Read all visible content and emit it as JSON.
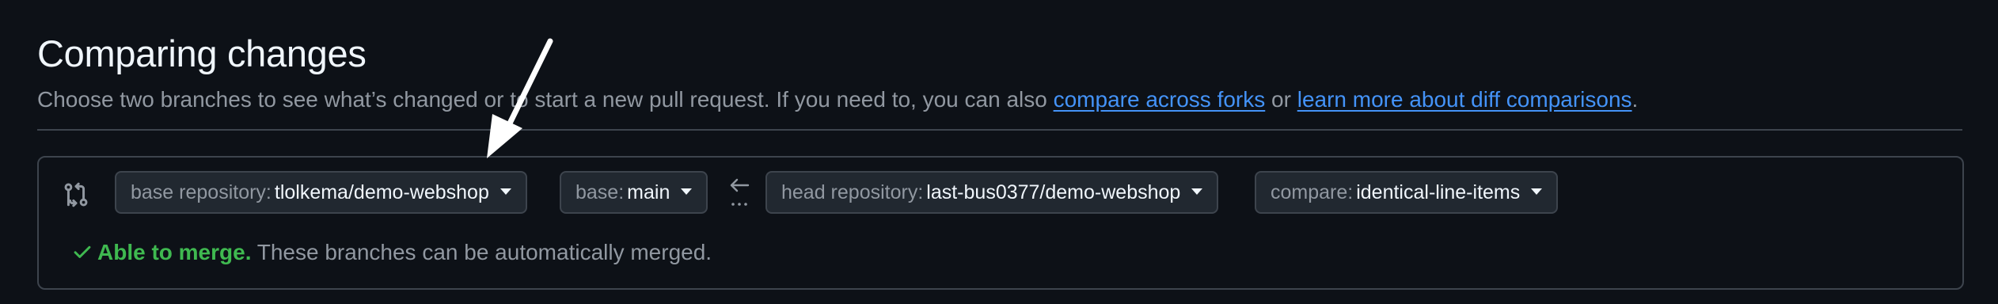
{
  "header": {
    "title": "Comparing changes",
    "subtitle_prefix": "Choose two branches to see what’s changed or to start a new pull request. If you need to, you can also ",
    "link_forks": "compare across forks",
    "subtitle_mid": " or ",
    "link_learn": "learn more about diff comparisons",
    "subtitle_suffix": "."
  },
  "compare_bar": {
    "base_repo_label": "base repository:",
    "base_repo_value": "tlolkema/demo-webshop",
    "base_label": "base:",
    "base_value": "main",
    "head_repo_label": "head repository:",
    "head_repo_value": "last-bus0377/demo-webshop",
    "compare_label": "compare:",
    "compare_value": "identical-line-items"
  },
  "merge_status": {
    "status": "Able to merge.",
    "message": " These branches can be automatically merged."
  },
  "colors": {
    "background": "#0d1117",
    "link": "#4493f8",
    "success": "#3fb950",
    "muted": "#9198a1"
  },
  "icons": [
    "git-compare-icon",
    "chevron-down-icon",
    "arrow-left-icon",
    "check-icon",
    "annotation-arrow-icon"
  ]
}
